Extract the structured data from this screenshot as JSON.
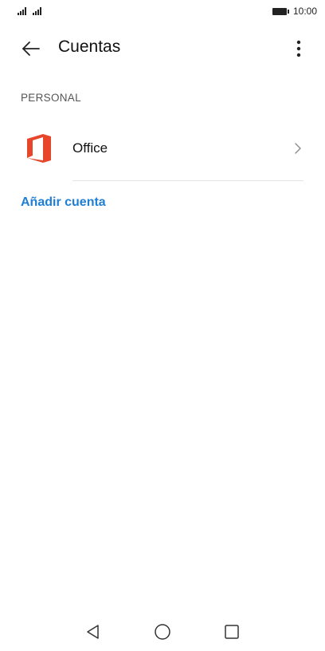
{
  "status_bar": {
    "time": "10:00"
  },
  "app_bar": {
    "title": "Cuentas",
    "back_icon": "arrow-left-icon",
    "more_icon": "more-vert-icon"
  },
  "section": {
    "label": "PERSONAL"
  },
  "accounts": [
    {
      "label": "Office",
      "icon": "office-icon",
      "icon_color": "#e8462a"
    }
  ],
  "add_account_label": "Añadir cuenta",
  "colors": {
    "accent": "#1f7ed6",
    "office": "#e8462a"
  },
  "nav_bar": {
    "back_icon": "nav-back-triangle-icon",
    "home_icon": "nav-home-circle-icon",
    "recent_icon": "nav-recent-square-icon"
  }
}
